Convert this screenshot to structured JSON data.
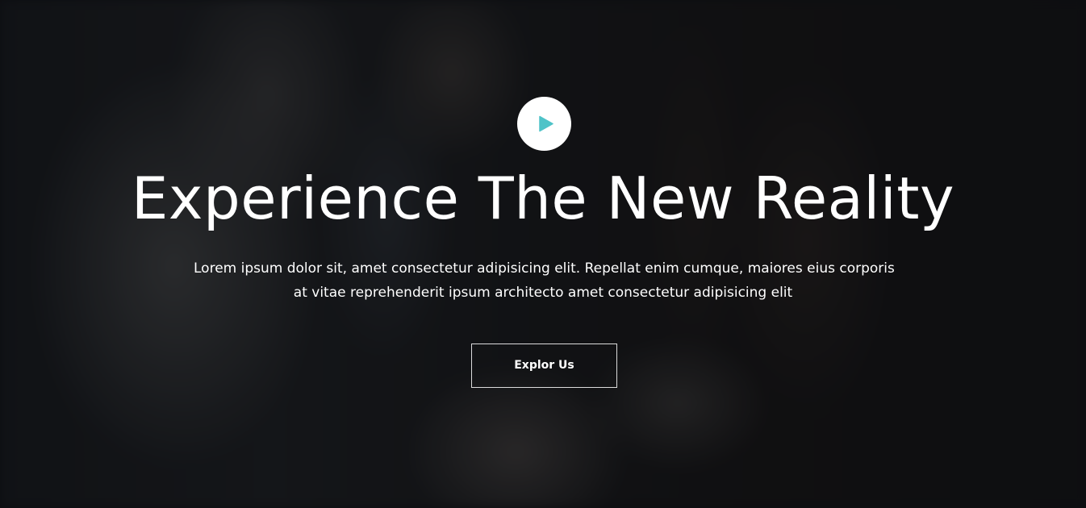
{
  "hero": {
    "title": "Experience The New Reality",
    "description_lines": [
      "Lorem ipsum dolor sit, amet consectetur adipisicing elit. Repellat enim cumque, maiores eius corporis",
      "at vitae reprehenderit ipsum architecto amet consectetur adipisicing elit"
    ],
    "button_label": "Explor Us",
    "play_icon": "play-icon"
  },
  "colors": {
    "accent": "#4fc3c8",
    "text": "#ffffff",
    "overlay": "#0a0b0e"
  }
}
